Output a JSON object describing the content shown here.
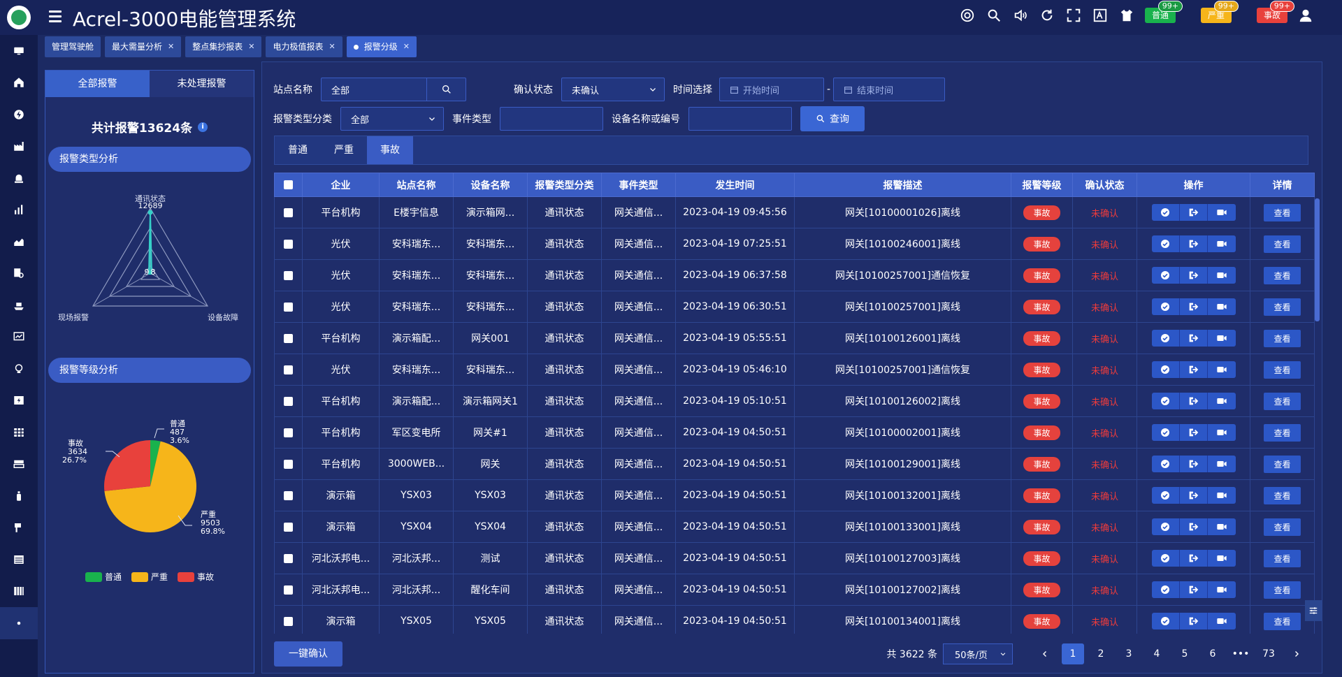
{
  "header": {
    "title": "Acrel-3000电能管理系统",
    "badges": [
      {
        "label": "普通",
        "count": "99+",
        "color": "#19b24d"
      },
      {
        "label": "严重",
        "count": "99+",
        "color": "#f6b51a"
      },
      {
        "label": "事故",
        "count": "99+",
        "color": "#e8413c"
      }
    ]
  },
  "tabs": [
    {
      "label": "管理驾驶舱",
      "closable": false
    },
    {
      "label": "最大需量分析",
      "closable": true
    },
    {
      "label": "整点集抄报表",
      "closable": true
    },
    {
      "label": "电力极值报表",
      "closable": true
    },
    {
      "label": "报警分级",
      "closable": true,
      "active": true
    }
  ],
  "left": {
    "tabs": [
      "全部报警",
      "未处理报警"
    ],
    "total_label": "共计报警13624条",
    "section1": "报警类型分析",
    "section2": "报警等级分析",
    "radar": {
      "top_label": "通讯状态",
      "top_value": "12689",
      "center_value": "9",
      "center_value2": "8",
      "left_label": "现场报警",
      "right_label": "设备故障"
    },
    "pie": {
      "normal": {
        "name": "普通",
        "value": "487",
        "pct": "3.6%"
      },
      "fault": {
        "name": "事故",
        "value": "3634",
        "pct": "26.7%"
      },
      "severe": {
        "name": "严重",
        "value": "9503",
        "pct": "69.8%"
      },
      "colors": {
        "normal": "#19b24d",
        "severe": "#f6b51a",
        "fault": "#e8413c"
      }
    },
    "legend": [
      "普通",
      "严重",
      "事故"
    ]
  },
  "filters": {
    "station_label": "站点名称",
    "station_value": "全部",
    "confirm_label": "确认状态",
    "confirm_value": "未确认",
    "time_label": "时间选择",
    "start_placeholder": "开始时间",
    "dash": "-",
    "end_placeholder": "结束时间",
    "type_label": "报警类型分类",
    "type_value": "全部",
    "event_label": "事件类型",
    "device_label": "设备名称或编号",
    "query_label": "查询"
  },
  "level_tabs": [
    "普通",
    "严重",
    "事故"
  ],
  "table": {
    "headers": [
      "企业",
      "站点名称",
      "设备名称",
      "报警类型分类",
      "事件类型",
      "发生时间",
      "报警描述",
      "报警等级",
      "确认状态",
      "操作",
      "详情"
    ],
    "rows": [
      [
        "平台机构",
        "E楼宇信息",
        "演示箱网...",
        "通讯状态",
        "网关通信...",
        "2023-04-19 09:45:56",
        "网关[10100001026]离线",
        "事故",
        "未确认",
        "",
        "查看"
      ],
      [
        "光伏",
        "安科瑞东...",
        "安科瑞东...",
        "通讯状态",
        "网关通信...",
        "2023-04-19 07:25:51",
        "网关[10100246001]离线",
        "事故",
        "未确认",
        "",
        "查看"
      ],
      [
        "光伏",
        "安科瑞东...",
        "安科瑞东...",
        "通讯状态",
        "网关通信...",
        "2023-04-19 06:37:58",
        "网关[10100257001]通信恢复",
        "事故",
        "未确认",
        "",
        "查看"
      ],
      [
        "光伏",
        "安科瑞东...",
        "安科瑞东...",
        "通讯状态",
        "网关通信...",
        "2023-04-19 06:30:51",
        "网关[10100257001]离线",
        "事故",
        "未确认",
        "",
        "查看"
      ],
      [
        "平台机构",
        "演示箱配...",
        "网关001",
        "通讯状态",
        "网关通信...",
        "2023-04-19 05:55:51",
        "网关[10100126001]离线",
        "事故",
        "未确认",
        "",
        "查看"
      ],
      [
        "光伏",
        "安科瑞东...",
        "安科瑞东...",
        "通讯状态",
        "网关通信...",
        "2023-04-19 05:46:10",
        "网关[10100257001]通信恢复",
        "事故",
        "未确认",
        "",
        "查看"
      ],
      [
        "平台机构",
        "演示箱配...",
        "演示箱网关1",
        "通讯状态",
        "网关通信...",
        "2023-04-19 05:10:51",
        "网关[10100126002]离线",
        "事故",
        "未确认",
        "",
        "查看"
      ],
      [
        "平台机构",
        "军区变电所",
        "网关#1",
        "通讯状态",
        "网关通信...",
        "2023-04-19 04:50:51",
        "网关[10100002001]离线",
        "事故",
        "未确认",
        "",
        "查看"
      ],
      [
        "平台机构",
        "3000WEB...",
        "网关",
        "通讯状态",
        "网关通信...",
        "2023-04-19 04:50:51",
        "网关[10100129001]离线",
        "事故",
        "未确认",
        "",
        "查看"
      ],
      [
        "演示箱",
        "YSX03",
        "YSX03",
        "通讯状态",
        "网关通信...",
        "2023-04-19 04:50:51",
        "网关[10100132001]离线",
        "事故",
        "未确认",
        "",
        "查看"
      ],
      [
        "演示箱",
        "YSX04",
        "YSX04",
        "通讯状态",
        "网关通信...",
        "2023-04-19 04:50:51",
        "网关[10100133001]离线",
        "事故",
        "未确认",
        "",
        "查看"
      ],
      [
        "河北沃邦电...",
        "河北沃邦...",
        "测试",
        "通讯状态",
        "网关通信...",
        "2023-04-19 04:50:51",
        "网关[10100127003]离线",
        "事故",
        "未确认",
        "",
        "查看"
      ],
      [
        "河北沃邦电...",
        "河北沃邦...",
        "醒化车间",
        "通讯状态",
        "网关通信...",
        "2023-04-19 04:50:51",
        "网关[10100127002]离线",
        "事故",
        "未确认",
        "",
        "查看"
      ],
      [
        "演示箱",
        "YSX05",
        "YSX05",
        "通讯状态",
        "网关通信...",
        "2023-04-19 04:50:51",
        "网关[10100134001]离线",
        "事故",
        "未确认",
        "",
        "查看"
      ]
    ]
  },
  "bottom": {
    "confirm_all": "一键确认",
    "total": "共 3622 条",
    "page_size": "50条/页",
    "pages": [
      "1",
      "2",
      "3",
      "4",
      "5",
      "6",
      "•••",
      "73"
    ]
  }
}
